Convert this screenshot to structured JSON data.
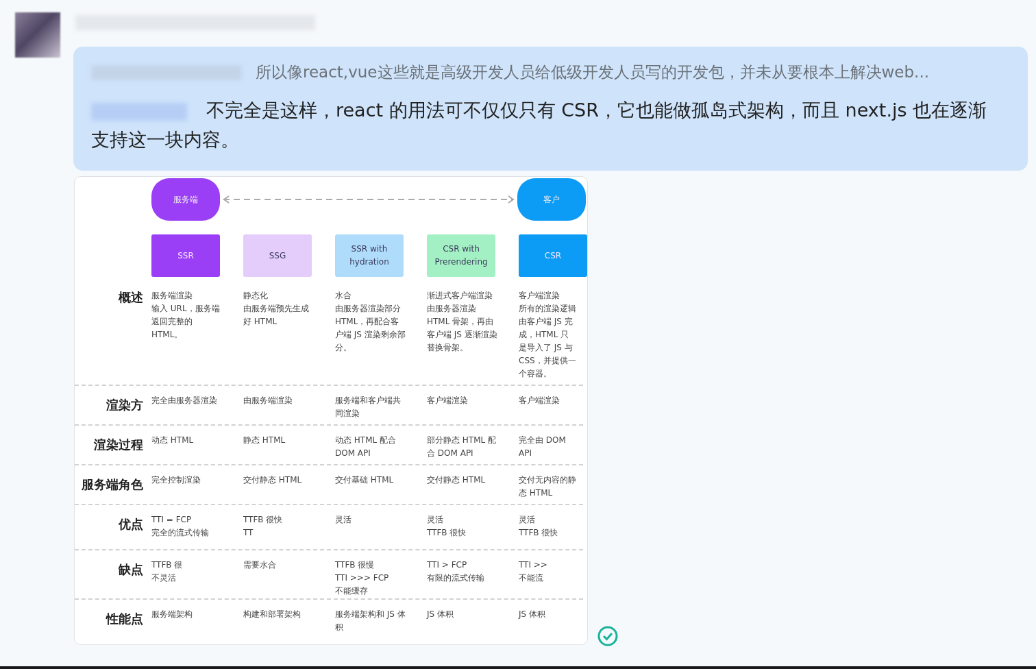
{
  "message": {
    "quote": "所以像react,vue这些就是高级开发人员给低级开发人员写的开发包，并未从要根本上解决web...",
    "reply": "不完全是这样，react 的用法可不仅仅只有 CSR，它也能做孤岛式架构，而且 next.js 也在逐渐支持这一块内容。"
  },
  "image": {
    "ends": [
      {
        "label": "服务端",
        "color": "#9b3ff6"
      },
      {
        "label": "客户",
        "color": "#0c9bf5"
      }
    ],
    "columns": [
      {
        "label": "SSR",
        "color": "#9b3ff6"
      },
      {
        "label": "SSG",
        "color": "#e5cdfb"
      },
      {
        "label": "SSR with\nhydration",
        "color": "#b0dcfb"
      },
      {
        "label": "CSR with\nPrerendering",
        "color": "#a3f0c4"
      },
      {
        "label": "CSR",
        "color": "#0c9bf5"
      }
    ],
    "rows": [
      {
        "label": "概述",
        "cells": [
          [
            "服务端渲染",
            "输入 URL，服务端返回完整的 HTML。"
          ],
          [
            "静态化",
            "由服务端预先生成好 HTML"
          ],
          [
            "水合",
            "由服务器渲染部分 HTML，再配合客户端 JS 渲染剩余部分。"
          ],
          [
            "渐进式客户端渲染",
            "由服务器渲染 HTML 骨架，再由客户端 JS 逐渐渲染替换骨架。"
          ],
          [
            "客户端渲染",
            "所有的渲染逻辑由客户端 JS 完成，HTML 只是导入了 JS 与 CSS，并提供一个容器。"
          ]
        ]
      },
      {
        "label": "渲染方",
        "cells": [
          [
            "完全由服务器渲染"
          ],
          [
            "由服务端渲染"
          ],
          [
            "服务端和客户端共同渲染"
          ],
          [
            "客户端渲染"
          ],
          [
            "客户端渲染"
          ]
        ]
      },
      {
        "label": "渲染过程",
        "cells": [
          [
            "动态 HTML"
          ],
          [
            "静态 HTML"
          ],
          [
            "动态 HTML 配合 DOM API"
          ],
          [
            "部分静态 HTML 配合 DOM API"
          ],
          [
            "完全由 DOM API"
          ]
        ]
      },
      {
        "label": "服务端角色",
        "cells": [
          [
            "完全控制渲染"
          ],
          [
            "交付静态 HTML"
          ],
          [
            "交付基础 HTML"
          ],
          [
            "交付静态 HTML"
          ],
          [
            "交付无内容的静态 HTML"
          ]
        ]
      },
      {
        "label": "优点",
        "cells": [
          [
            "TTI = FCP",
            "完全的流式传输"
          ],
          [
            "TTFB 很快",
            "TT"
          ],
          [
            "灵活"
          ],
          [
            "灵活",
            "TTFB 很快"
          ],
          [
            "灵活",
            "TTFB 很快"
          ]
        ]
      },
      {
        "label": "缺点",
        "cells": [
          [
            "TTFB 很",
            "不灵活"
          ],
          [
            "需要水合"
          ],
          [
            "TTFB 很慢",
            "TTI >>> FCP",
            "不能缓存"
          ],
          [
            "TTI > FCP",
            "有限的流式传输"
          ],
          [
            "TTI >>",
            "不能流"
          ]
        ]
      },
      {
        "label": "性能点",
        "cells": [
          [
            "服务端架构"
          ],
          [
            "构建和部署架构"
          ],
          [
            "服务端架构和 JS 体积"
          ],
          [
            "JS 体积"
          ],
          [
            "JS 体积"
          ]
        ]
      }
    ]
  },
  "status": {
    "read": true
  }
}
